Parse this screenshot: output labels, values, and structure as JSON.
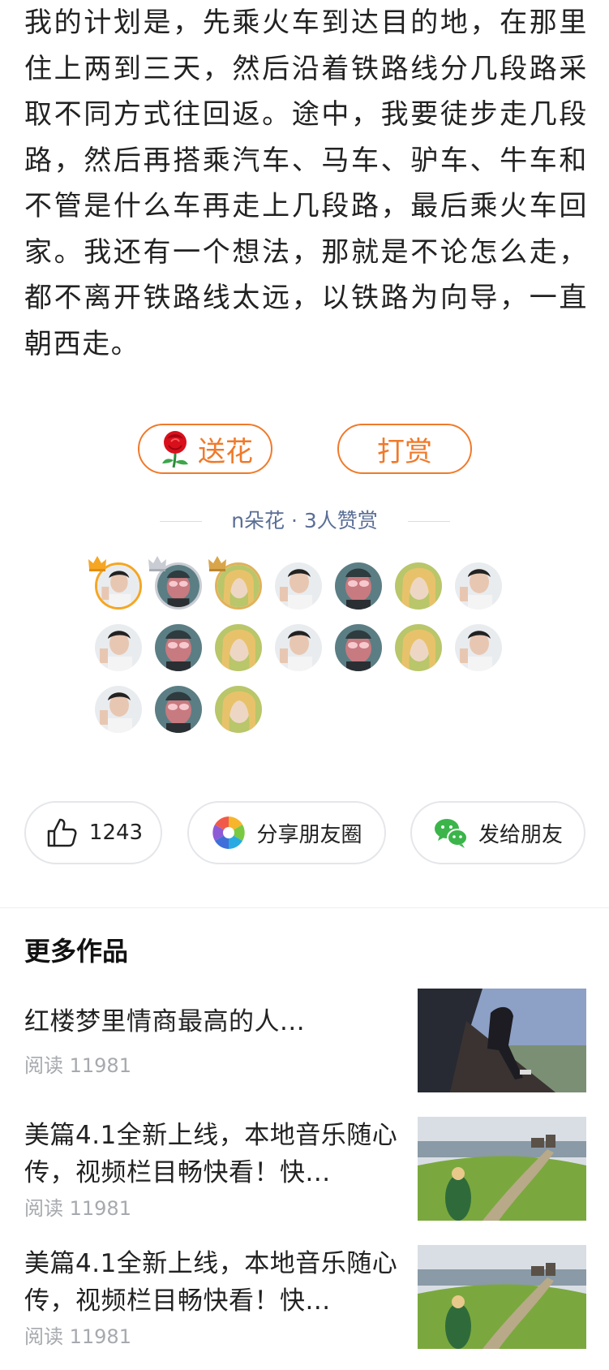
{
  "article": {
    "text": "我的计划是，先乘火车到达目的地，在那里住上两到三天，然后沿着铁路线分几段路采取不同方式往回返。途中，我要徒步走几段路，然后再搭乘汽车、马车、驴车、牛车和不管是什么车再走上几段路，最后乘火车回家。我还有一个想法，那就是不论怎么走，都不离开铁路线太远，以铁路为向导，一直朝西走。"
  },
  "buttons": {
    "flower_label": "送花",
    "tip_label": "打赏"
  },
  "stats": {
    "text": "n朵花 · 3人赞赏"
  },
  "actions": {
    "like_count": "1243",
    "share_label": "分享朋友圈",
    "send_label": "发给朋友"
  },
  "more": {
    "title": "更多作品",
    "items": [
      {
        "title": "红楼梦里情商最高的人...",
        "meta": "阅读 11981"
      },
      {
        "title": "美篇4.1全新上线，本地音乐随心传，视频栏目畅快看！快...",
        "meta": "阅读 11981"
      },
      {
        "title": "美篇4.1全新上线，本地音乐随心传，视频栏目畅快看！快...",
        "meta": "阅读 11981"
      }
    ]
  },
  "colors": {
    "accent_orange": "#f07a2a",
    "stats_blue": "#5a6e96",
    "meta_gray": "#a6a9ae",
    "wechat_green": "#3bb54a"
  }
}
